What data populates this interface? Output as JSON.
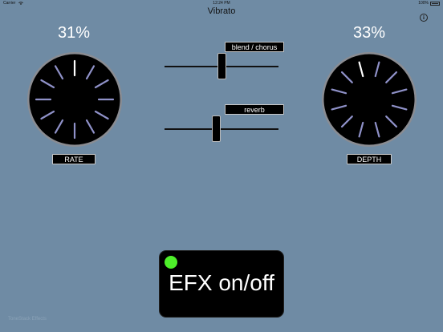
{
  "status_bar": {
    "carrier": "Carrier",
    "time": "12:24 PM",
    "battery": "100%"
  },
  "header": {
    "title": "Vibrato",
    "info_icon": "info-icon",
    "info_glyph": "i"
  },
  "rate": {
    "percent": "31%",
    "label": "RATE",
    "value": 0.31
  },
  "depth": {
    "percent": "33%",
    "label": "DEPTH",
    "value": 0.33
  },
  "sliders": {
    "blend": {
      "label": "blend / chorus",
      "value": 0.5
    },
    "reverb": {
      "label": "reverb",
      "value": 0.45
    }
  },
  "efx_button": {
    "label": "EFX on/off",
    "led_color": "#4ef02a"
  },
  "colors": {
    "background": "#6f8ba4",
    "knob_body": "#000000",
    "knob_ticks": "#8f91c8",
    "knob_ticks_active": "#ffffff"
  },
  "watermark": "ToneStack Effects"
}
